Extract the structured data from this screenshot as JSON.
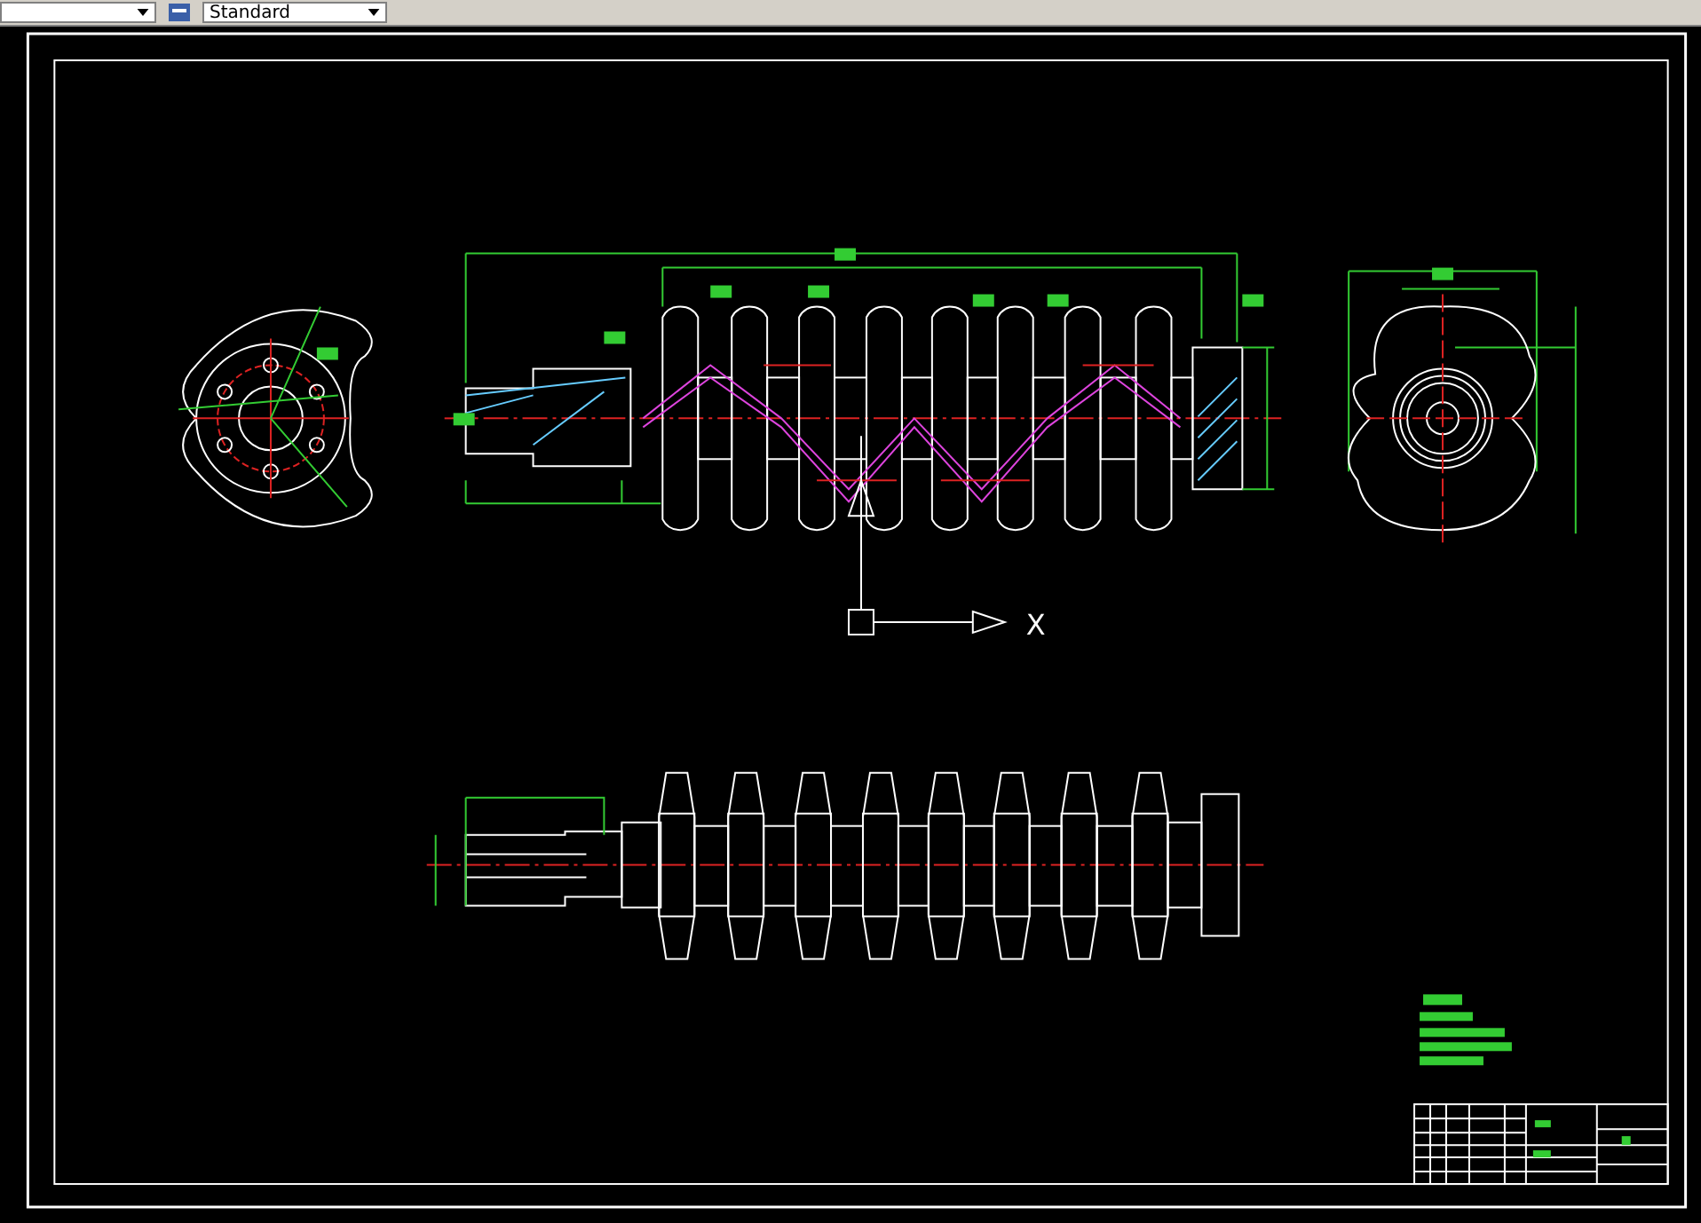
{
  "toolbar": {
    "text_style": "Standard"
  },
  "ucs_icon": {
    "x_label": "X"
  }
}
